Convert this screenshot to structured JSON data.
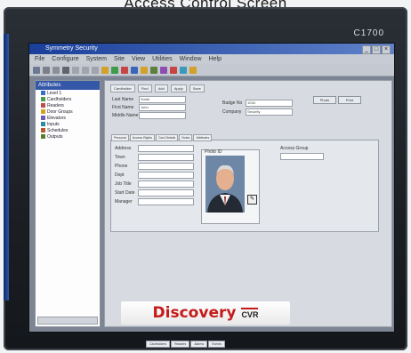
{
  "caption": "Access Control Screen",
  "monitor": {
    "model": "C1700"
  },
  "window": {
    "title": "Symmetry Security"
  },
  "menu": [
    "File",
    "Configure",
    "System",
    "Site",
    "View",
    "Utilities",
    "Window",
    "Help"
  ],
  "tree": {
    "header": "Attributes",
    "items": [
      {
        "label": "Level 1",
        "color": "#3b6dc7"
      },
      {
        "label": "Cardholders",
        "color": "#4a9c4a"
      },
      {
        "label": "Readers",
        "color": "#c24b4b"
      },
      {
        "label": "Door Groups",
        "color": "#d6a11b"
      },
      {
        "label": "Elevators",
        "color": "#6f5bb3"
      },
      {
        "label": "Inputs",
        "color": "#2b8aa6"
      },
      {
        "label": "Schedules",
        "color": "#b2592f"
      },
      {
        "label": "Outputs",
        "color": "#5b7d2f"
      }
    ]
  },
  "form": {
    "top_tabs": [
      "Cardholder",
      "Find",
      "Add",
      "Apply",
      "Save"
    ],
    "fields": [
      {
        "label": "Last Name",
        "value": "Smith"
      },
      {
        "label": "First Name",
        "value": "John"
      },
      {
        "label": "Middle Name",
        "value": ""
      },
      {
        "label": "Badge No",
        "value": "1034"
      },
      {
        "label": "Company",
        "value": "Security"
      }
    ],
    "side_buttons": [
      "Photo",
      "Print"
    ],
    "subtabs": [
      "Personal",
      "Access Rights",
      "Card Details",
      "Notes",
      "Attributes"
    ],
    "detail_labels": [
      "Address",
      "Town",
      "Phone",
      "Dept",
      "Job Title",
      "Start Date",
      "Manager"
    ],
    "photo_label": "Photo ID",
    "group_label": "Access Group"
  },
  "bottom_tabs": [
    "Cardholders",
    "Readers",
    "Alarms",
    "Events"
  ],
  "brand": {
    "name": "Discovery",
    "tag": "CVR"
  }
}
